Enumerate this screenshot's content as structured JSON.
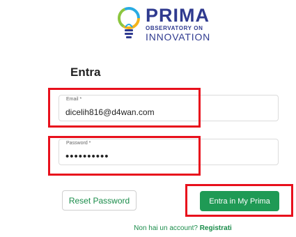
{
  "logo": {
    "name": "PRIMA",
    "line1": "OBSERVATORY ON",
    "line2": "INNOVATION"
  },
  "form": {
    "title": "Entra",
    "email": {
      "label": "Email *",
      "value": "dicelih816@d4wan.com"
    },
    "password": {
      "label": "Password *",
      "value": "••••••••••"
    },
    "reset_label": "Reset Password",
    "submit_label": "Entra in My Prima",
    "signup_prompt": "Non hai un account?",
    "signup_link": "Registrati"
  },
  "colors": {
    "brand": "#2f3a8f",
    "accent": "#1f9a55",
    "highlight": "#e8101c"
  }
}
